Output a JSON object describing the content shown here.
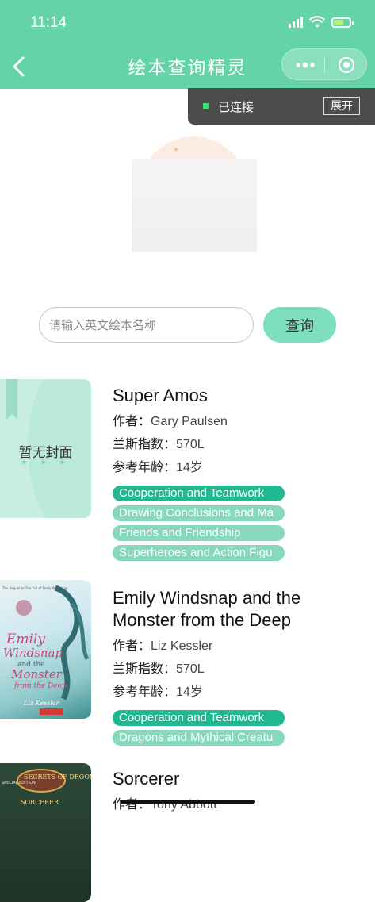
{
  "status": {
    "time": "11:14"
  },
  "nav": {
    "title": "绘本查询精灵"
  },
  "connection": {
    "status": "已连接",
    "expand_label": "展开",
    "dot_color": "#3fe06e"
  },
  "search": {
    "placeholder": "请输入英文绘本名称",
    "value": "",
    "button_label": "查询"
  },
  "colors": {
    "brand": "#64d3a9",
    "tag_primary": "#1fb890",
    "tag_secondary": "#86d9bd"
  },
  "labels": {
    "author": "作者：",
    "lexile": "兰斯指数：",
    "age": "参考年龄："
  },
  "books": [
    {
      "title": "Super Amos",
      "cover_placeholder": "暂无封面",
      "cover_stars": "★ ★ ★",
      "author": "Gary Paulsen",
      "lexile": "570L",
      "age": "14岁",
      "tags": [
        "Cooperation and Teamwork",
        "Drawing Conclusions and Ma",
        "Friends and Friendship",
        "Superheroes and Action Figu"
      ]
    },
    {
      "title": "Emily Windsnap and the Monster from the Deep",
      "cover_lines": [
        "Emily",
        "Windsnap",
        "and the",
        "Monster",
        "from the Deep"
      ],
      "cover_author": "Liz Kessler",
      "cover_top": "The Sequel to The Tail of Emily Windsnap",
      "author": "Liz Kessler",
      "lexile": "570L",
      "age": "14岁",
      "tags": [
        "Cooperation and Teamwork",
        "Dragons and Mythical Creatu"
      ]
    },
    {
      "title": "Sorcerer",
      "cover_series": "SECRETS OF DROON",
      "cover_text": "SORCERER",
      "cover_special": "SPECIAL EDITION",
      "author": "Tony Abbott"
    }
  ]
}
